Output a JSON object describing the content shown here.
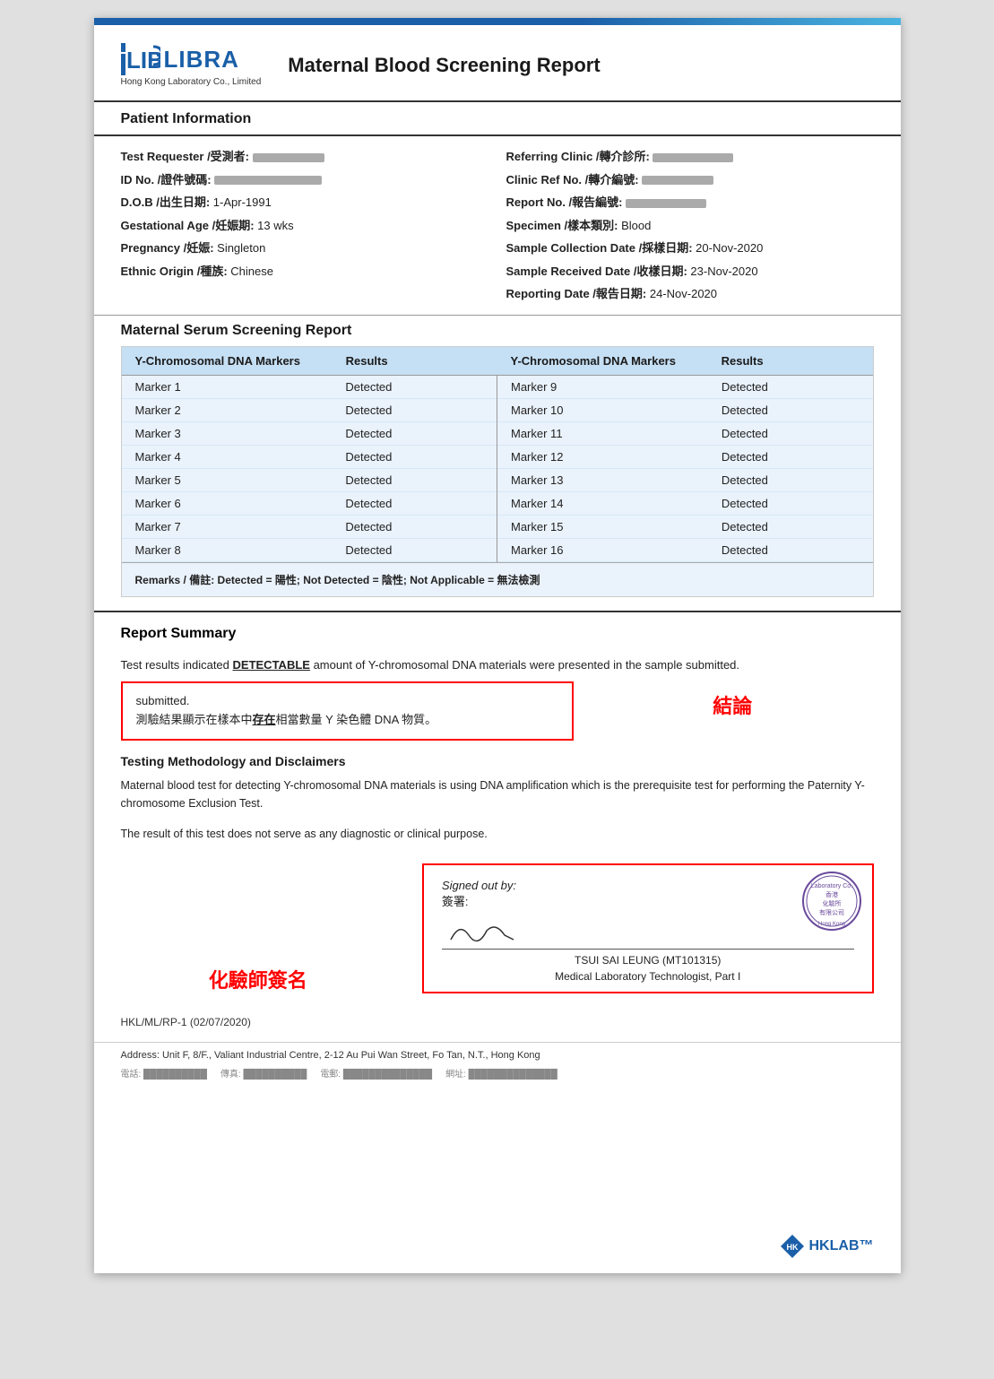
{
  "header": {
    "logo_text": "LIBRA",
    "logo_subtitle": "Hong Kong Laboratory Co., Limited",
    "report_title": "Maternal Blood Screening Report"
  },
  "patient_info": {
    "section_title": "Patient Information",
    "left": [
      {
        "label": "Test Requester /受測者:",
        "value": "redacted"
      },
      {
        "label": "ID No. /證件號碼:",
        "value": "redacted"
      },
      {
        "label": "D.O.B /出生日期:",
        "value": "1-Apr-1991"
      },
      {
        "label": "Gestational Age /妊娠期:",
        "value": "13 wks"
      },
      {
        "label": "Pregnancy /妊娠:",
        "value": "Singleton"
      },
      {
        "label": "Ethnic Origin /種族:",
        "value": "Chinese"
      }
    ],
    "right": [
      {
        "label": "Referring Clinic /轉介診所:",
        "value": "redacted"
      },
      {
        "label": "Clinic Ref No. /轉介編號:",
        "value": "redacted"
      },
      {
        "label": "Report No. /報告編號:",
        "value": "redacted"
      },
      {
        "label": "Specimen /樣本類別:",
        "value": "Blood"
      },
      {
        "label": "Sample Collection Date /採樣日期:",
        "value": "20-Nov-2020"
      },
      {
        "label": "Sample Received Date /收樣日期:",
        "value": "23-Nov-2020"
      },
      {
        "label": "Reporting Date /報告日期:",
        "value": "24-Nov-2020"
      }
    ]
  },
  "serum_section": {
    "title": "Maternal Serum Screening Report",
    "col1_header": "Y-Chromosomal DNA Markers",
    "col2_header": "Results",
    "col3_header": "Y-Chromosomal DNA Markers",
    "col4_header": "Results",
    "left_markers": [
      {
        "marker": "Marker 1",
        "result": "Detected"
      },
      {
        "marker": "Marker 2",
        "result": "Detected"
      },
      {
        "marker": "Marker 3",
        "result": "Detected"
      },
      {
        "marker": "Marker 4",
        "result": "Detected"
      },
      {
        "marker": "Marker 5",
        "result": "Detected"
      },
      {
        "marker": "Marker 6",
        "result": "Detected"
      },
      {
        "marker": "Marker 7",
        "result": "Detected"
      },
      {
        "marker": "Marker 8",
        "result": "Detected"
      }
    ],
    "right_markers": [
      {
        "marker": "Marker 9",
        "result": "Detected"
      },
      {
        "marker": "Marker 10",
        "result": "Detected"
      },
      {
        "marker": "Marker 11",
        "result": "Detected"
      },
      {
        "marker": "Marker 12",
        "result": "Detected"
      },
      {
        "marker": "Marker 13",
        "result": "Detected"
      },
      {
        "marker": "Marker 14",
        "result": "Detected"
      },
      {
        "marker": "Marker 15",
        "result": "Detected"
      },
      {
        "marker": "Marker 16",
        "result": "Detected"
      }
    ],
    "remarks": "Remarks / 備註: Detected = 陽性; Not Detected = 陰性; Not Applicable = 無法檢測"
  },
  "report_summary": {
    "title": "Report Summary",
    "text_before": "Test results indicated ",
    "detectable_word": "DETECTABLE",
    "text_after": " amount of Y-chromosomal DNA materials were presented in the sample submitted.",
    "red_box_line1": "submitted.",
    "red_box_line2": "測驗結果顯示在樣本中",
    "red_box_underline": "存在",
    "red_box_line3": "相當數量 Y 染色體 DNA 物質。",
    "conclusion_label": "結論"
  },
  "methodology": {
    "title": "Testing Methodology and Disclaimers",
    "text1": "Maternal blood test for detecting Y-chromosomal DNA materials is using DNA amplification which is the prerequisite test for performing the Paternity Y-chromosome Exclusion Test.",
    "text2": "The result of this test does not serve as any diagnostic or clinical purpose."
  },
  "signature_section": {
    "label_red": "化驗師簽名",
    "signed_out_label": "Signed out by:",
    "signed_chinese": "簽署:",
    "signer_name": "TSUI SAI LEUNG (MT101315)",
    "signer_title": "Medical Laboratory Technologist, Part I"
  },
  "footer": {
    "ref": "HKL/ML/RP-1 (02/07/2020)",
    "address": "Address: Unit F, 8/F., Valiant Industrial Centre, 2-12 Au Pui Wan Street, Fo Tan, N.T., Hong Kong",
    "hklab_tm": "HKLAB™"
  }
}
